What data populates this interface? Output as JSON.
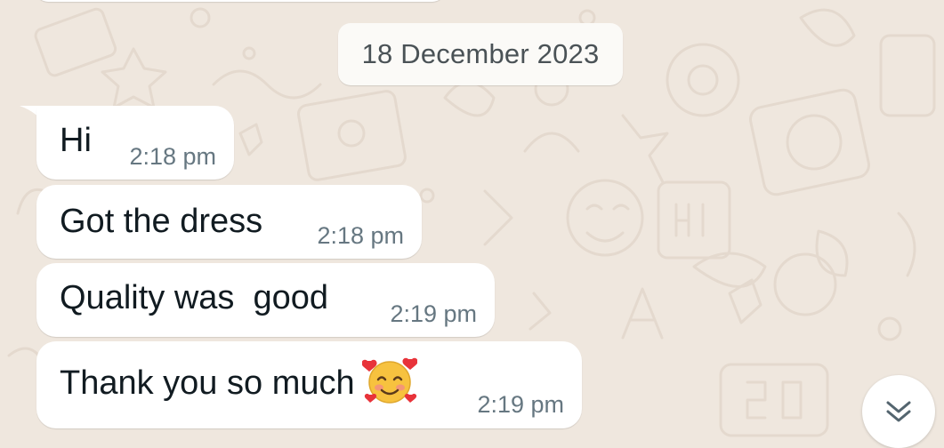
{
  "chat": {
    "date_divider": "18 December 2023",
    "messages": [
      {
        "text": "Hi",
        "time": "2:18 pm"
      },
      {
        "text": "Got the dress",
        "time": "2:18 pm"
      },
      {
        "text": "Quality was  good",
        "time": "2:19 pm"
      },
      {
        "text": "Thank you so much",
        "time": "2:19 pm",
        "emoji": "smiling-face-with-hearts"
      }
    ]
  },
  "scroll_button": {
    "icon": "double-chevron-down-icon"
  },
  "colors": {
    "background": "#efe7de",
    "bubble": "#ffffff",
    "time_text": "#667781",
    "message_text": "#111b21",
    "scroll_icon": "#54656f"
  }
}
